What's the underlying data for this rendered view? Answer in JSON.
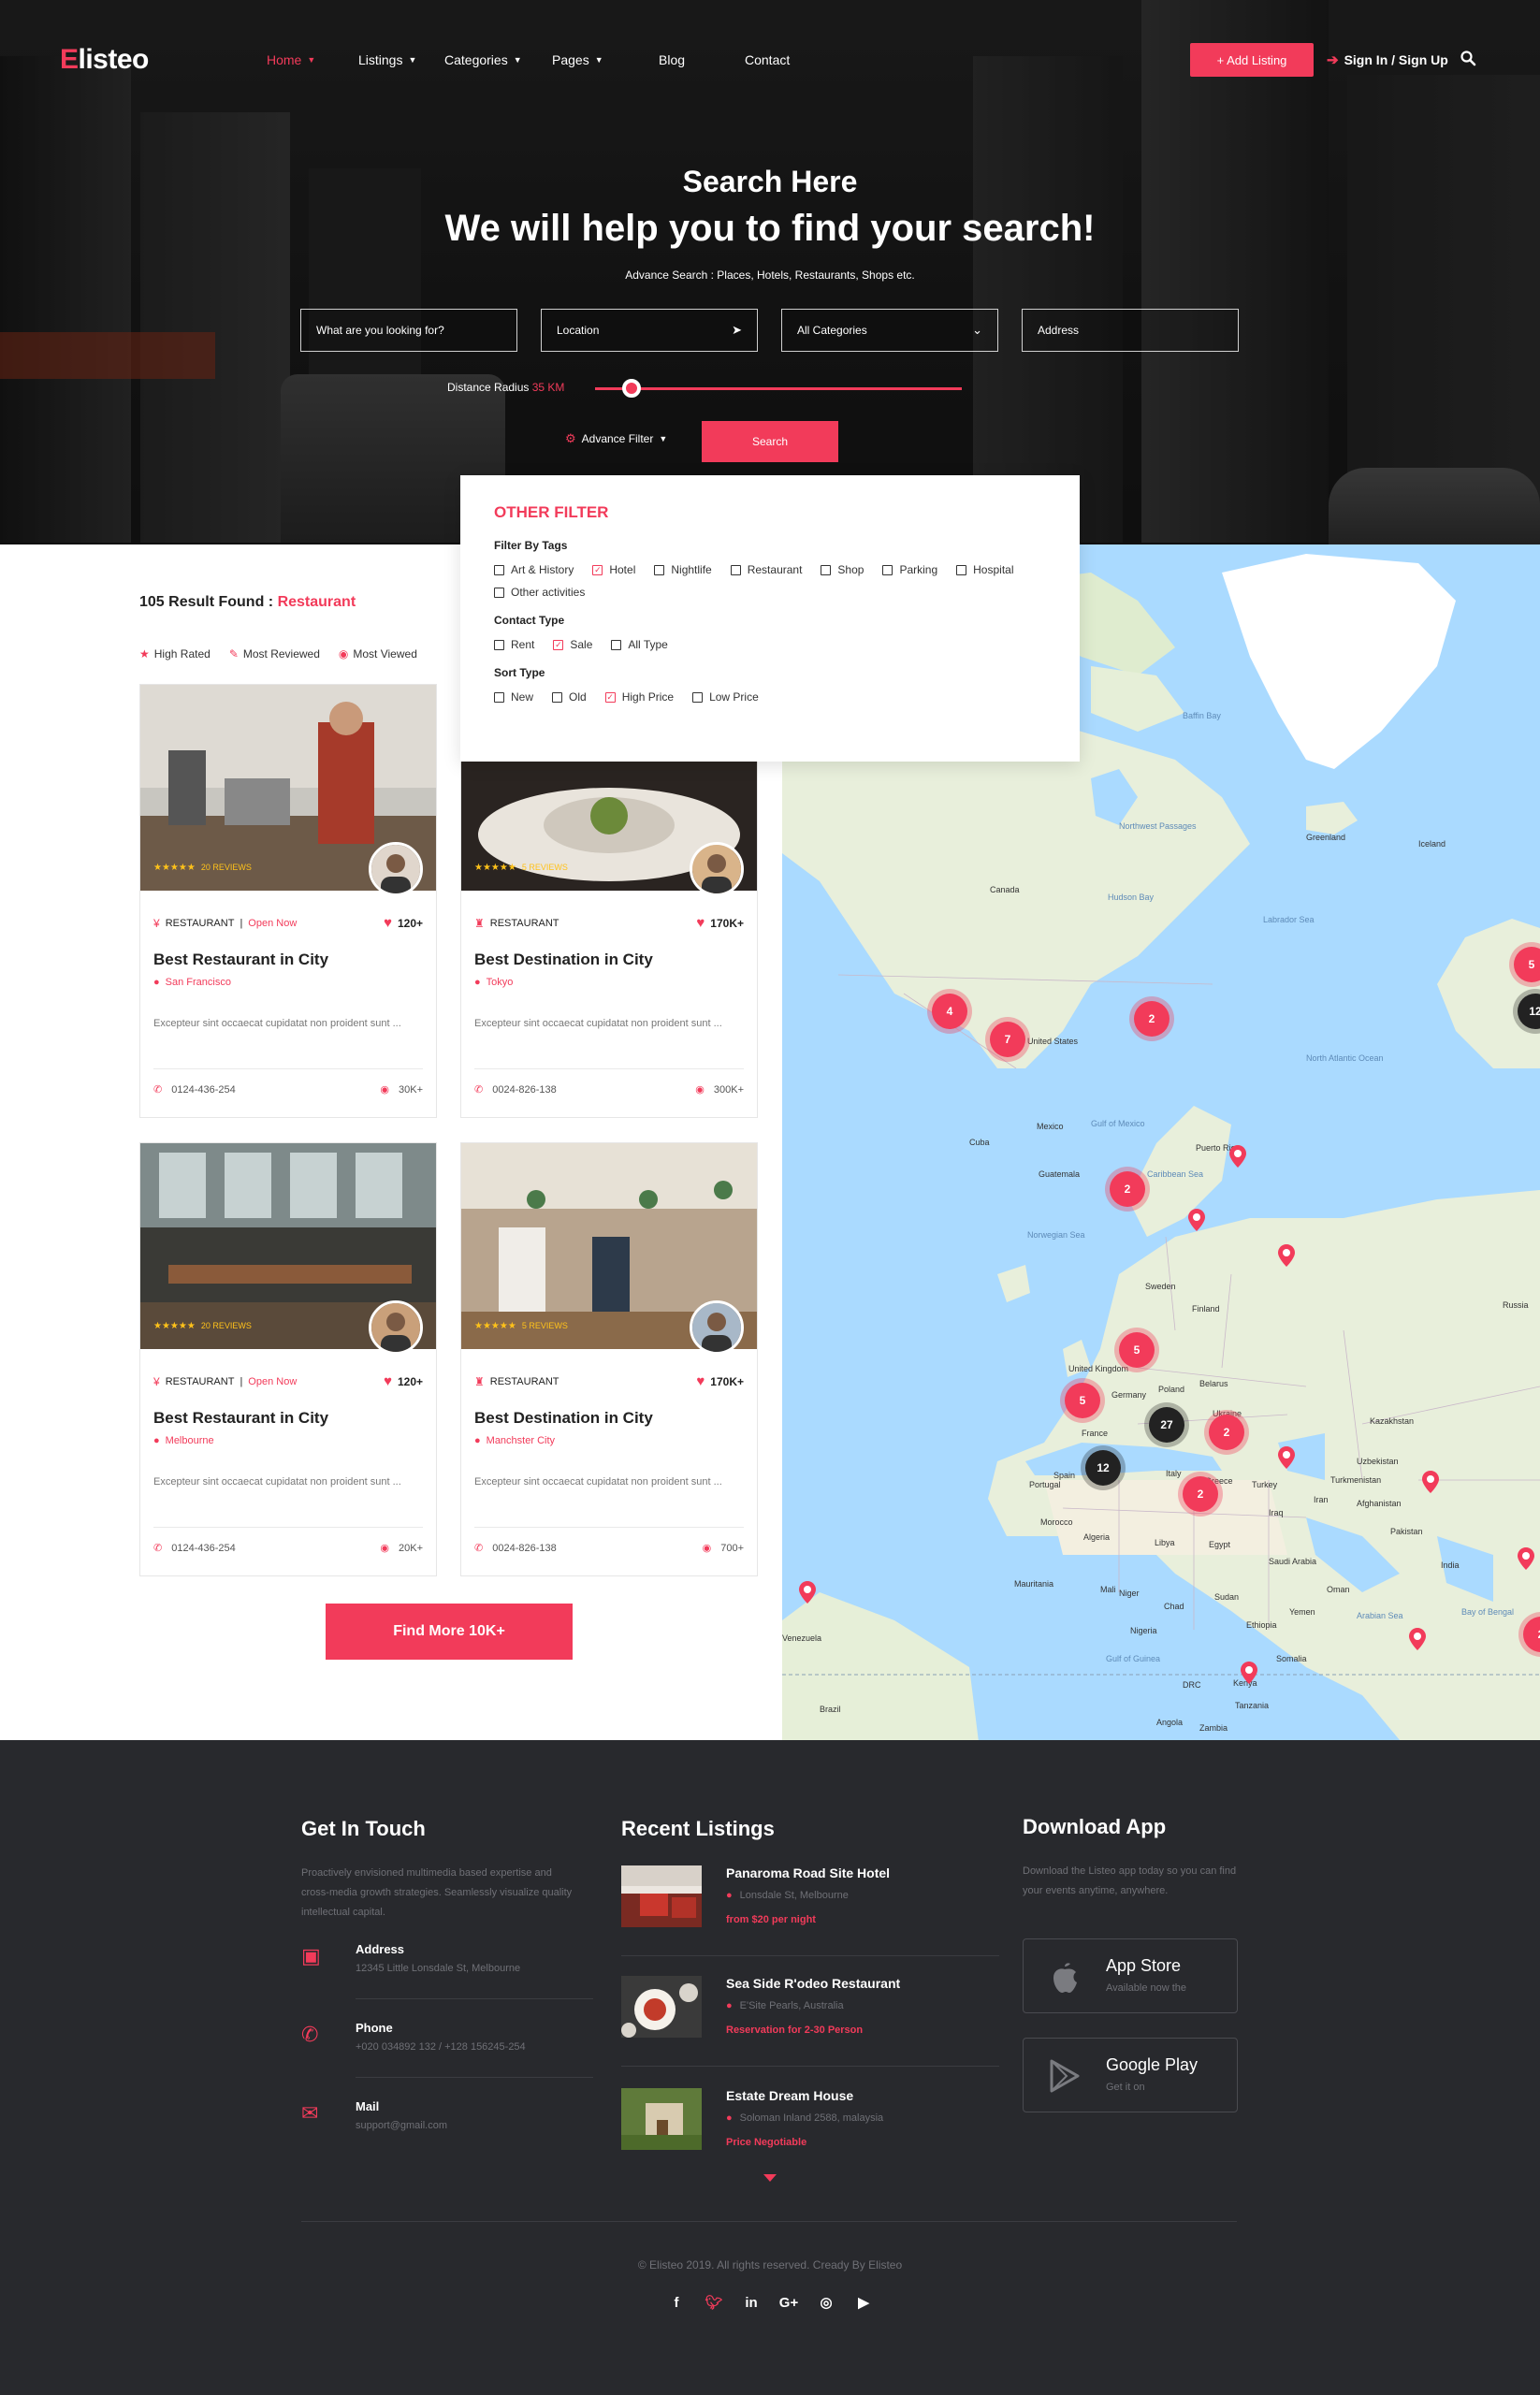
{
  "brand": {
    "logo_first": "E",
    "logo_rest": "listeo",
    "accent": "#f23b5a"
  },
  "nav": {
    "items": [
      {
        "label": "Home",
        "dropdown": true,
        "active": true
      },
      {
        "label": "Listings",
        "dropdown": true
      },
      {
        "label": "Categories",
        "dropdown": true
      },
      {
        "label": "Pages",
        "dropdown": true
      },
      {
        "label": "Blog",
        "dropdown": false
      },
      {
        "label": "Contact",
        "dropdown": false
      }
    ],
    "add_listing": "+ Add Listing",
    "sign_in": "Sign In / Sign Up"
  },
  "hero": {
    "subtitle": "Search Here",
    "title": "We will help you to find your search!",
    "description": "Advance Search : Places, Hotels, Restaurants, Shops etc.",
    "fields": {
      "keyword_placeholder": "What are you looking for?",
      "location": "Location",
      "category": "All Categories",
      "address": "Address"
    },
    "radius_label": "Distance Radius",
    "radius_value": "35 KM",
    "radius_fraction": 0.1,
    "advance_filter": "Advance Filter",
    "search_button": "Search"
  },
  "filter": {
    "title": "OTHER FILTER",
    "tags_label": "Filter By Tags",
    "tags": [
      {
        "label": "Art & History",
        "checked": false
      },
      {
        "label": "Hotel",
        "checked": true
      },
      {
        "label": "Nightlife",
        "checked": false
      },
      {
        "label": "Restaurant",
        "checked": false
      },
      {
        "label": "Shop",
        "checked": false
      },
      {
        "label": "Parking",
        "checked": false
      },
      {
        "label": "Hospital",
        "checked": false
      },
      {
        "label": "Other activities",
        "checked": false
      }
    ],
    "contact_label": "Contact Type",
    "contact": [
      {
        "label": "Rent",
        "checked": false
      },
      {
        "label": "Sale",
        "checked": true
      },
      {
        "label": "All Type",
        "checked": false
      }
    ],
    "sort_label": "Sort Type",
    "sort": [
      {
        "label": "New",
        "checked": false
      },
      {
        "label": "Old",
        "checked": false
      },
      {
        "label": "High Price",
        "checked": true
      },
      {
        "label": "Low Price",
        "checked": false
      }
    ]
  },
  "results": {
    "count_text": "105 Result Found : ",
    "category": "Restaurant",
    "sort_tabs": [
      "High Rated",
      "Most Reviewed",
      "Most Viewed"
    ]
  },
  "cards": [
    {
      "category": "RESTAURANT",
      "status": "Open Now",
      "likes": "120+",
      "title": "Best Restaurant in City",
      "location": "San Francisco",
      "desc": "Excepteur sint occaecat cupidatat non proident sunt ...",
      "phone": "0124-436-254",
      "views": "30K+",
      "reviews": "20 REVIEWS",
      "rating": 5
    },
    {
      "category": "RESTAURANT",
      "status": "",
      "likes": "170K+",
      "title": "Best Destination in City",
      "location": "Tokyo",
      "desc": "Excepteur sint occaecat cupidatat non proident sunt ...",
      "phone": "0024-826-138",
      "views": "300K+",
      "reviews": "5 REVIEWS",
      "rating": 5
    },
    {
      "category": "RESTAURANT",
      "status": "Open Now",
      "likes": "120+",
      "title": "Best Restaurant in City",
      "location": "Melbourne",
      "desc": "Excepteur sint occaecat cupidatat non proident sunt ...",
      "phone": "0124-436-254",
      "views": "20K+",
      "reviews": "20 REVIEWS",
      "rating": 5
    },
    {
      "category": "RESTAURANT",
      "status": "",
      "likes": "170K+",
      "title": "Best Destination in City",
      "location": "Manchster City",
      "desc": "Excepteur sint occaecat cupidatat non proident sunt ...",
      "phone": "0024-826-138",
      "views": "700+",
      "reviews": "5 REVIEWS",
      "rating": 5
    }
  ],
  "find_more": "Find More 10K+",
  "map": {
    "labels": [
      "Greenland",
      "Iceland",
      "Canada",
      "United States",
      "Mexico",
      "North Atlantic Ocean",
      "Norwegian Sea",
      "Sweden",
      "Finland",
      "Russia",
      "United Kingdom",
      "Germany",
      "France",
      "Poland",
      "Ukraine",
      "Kazakhstan",
      "Turkey",
      "Iraq",
      "Iran",
      "Algeria",
      "Libya",
      "Egypt",
      "Saudi Arabia",
      "Mali",
      "Niger",
      "Chad",
      "Sudan",
      "Nigeria",
      "Ethiopia",
      "Somalia",
      "Kenya",
      "Tanzania",
      "DRC",
      "Angola",
      "Zambia",
      "Brazil",
      "Venezuela",
      "Morocco",
      "Spain",
      "Portugal",
      "Italy",
      "Afghanistan",
      "India",
      "Uzbekistan",
      "Turkmenistan",
      "Yemen",
      "Oman",
      "Pakistan",
      "Mauritania",
      "Greece",
      "Belarus",
      "Arabian Sea",
      "Bay of Bengal",
      "Cuba",
      "Puerto Rico",
      "Guatemala",
      "Baffin Bay",
      "Hudson Bay",
      "Labrador Sea",
      "Caribbean Sea",
      "Gulf of Mexico",
      "Northwest Passages",
      "Gulf of Guinea"
    ],
    "clusters": [
      {
        "value": "4",
        "color": "red"
      },
      {
        "value": "7",
        "color": "red"
      },
      {
        "value": "2",
        "color": "red"
      },
      {
        "value": "5",
        "color": "red"
      },
      {
        "value": "12",
        "color": "dark"
      },
      {
        "value": "2",
        "color": "red"
      },
      {
        "value": "5",
        "color": "red"
      },
      {
        "value": "5",
        "color": "red"
      },
      {
        "value": "27",
        "color": "dark"
      },
      {
        "value": "2",
        "color": "red"
      },
      {
        "value": "12",
        "color": "dark"
      },
      {
        "value": "2",
        "color": "red"
      },
      {
        "value": "2",
        "color": "red"
      }
    ]
  },
  "footer": {
    "touch_title": "Get In Touch",
    "touch_text": "Proactively envisioned multimedia based expertise and cross-media growth strategies. Seamlessly visualize quality intellectual capital.",
    "contacts": [
      {
        "label": "Address",
        "value": "12345 Little Lonsdale St, Melbourne",
        "icon": "map-icon"
      },
      {
        "label": "Phone",
        "value": "+020 034892 132  /  +128 156245-254",
        "icon": "phone-icon"
      },
      {
        "label": "Mail",
        "value": "support@gmail.com",
        "icon": "mail-icon"
      }
    ],
    "recent_title": "Recent Listings",
    "recent": [
      {
        "title": "Panaroma  Road Site  Hotel",
        "location": "Lonsdale  St, Melbourne",
        "price": "from $20 per night"
      },
      {
        "title": "Sea Side R'odeo Restaurant",
        "location": "E'Site Pearls, Australia",
        "price": "Reservation for 2-30 Person"
      },
      {
        "title": "Estate Dream House",
        "location": "Soloman Inland 2588, malaysia",
        "price": "Price Negotiable"
      }
    ],
    "app_title": "Download App",
    "app_text": "Download the Listeo  app today so you can find your events anytime, anywhere.",
    "stores": [
      {
        "title": "App Store",
        "sub": "Available now  the",
        "icon": "apple-icon"
      },
      {
        "title": "Google Play",
        "sub": "Get it on",
        "icon": "google-play-icon"
      }
    ],
    "copyright": "© Elisteo 2019. All rights reserved.  Cready By Elisteo",
    "socials": [
      "f",
      "t",
      "in",
      "G+",
      "ig",
      "yt"
    ]
  }
}
